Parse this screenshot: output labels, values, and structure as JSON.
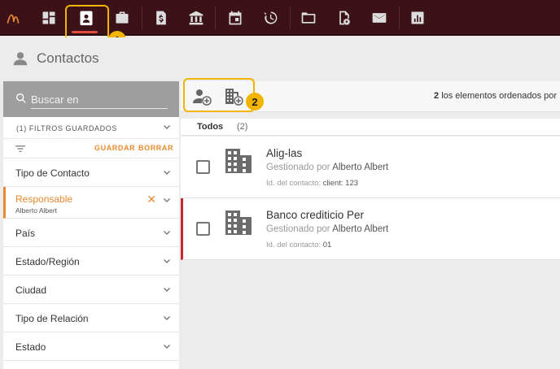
{
  "nav": {
    "items": [
      {
        "icon": "logo-icon"
      },
      {
        "icon": "dashboard-icon"
      },
      {
        "icon": "contacts-icon",
        "active": true
      },
      {
        "icon": "briefcase-icon"
      },
      {
        "icon": "billing-icon"
      },
      {
        "icon": "bank-icon"
      },
      {
        "icon": "calendar-icon"
      },
      {
        "icon": "time-icon"
      },
      {
        "icon": "folder-icon"
      },
      {
        "icon": "document-settings-icon"
      },
      {
        "icon": "mail-icon"
      },
      {
        "icon": "reports-icon"
      }
    ],
    "colors": {
      "background": "#3b1218",
      "active_underline": "#e24a3b",
      "callout": "#f2b400"
    }
  },
  "callouts": [
    "1",
    "2"
  ],
  "page": {
    "title": "Contactos",
    "icon": "person-icon"
  },
  "filters": {
    "search_placeholder": "Buscar en",
    "saved_filters_label": "(1) FILTROS GUARDADOS",
    "save_label": "GUARDAR",
    "clear_label": "BORRAR",
    "items": [
      {
        "label": "Tipo de Contacto"
      },
      {
        "label": "Responsable",
        "value": "Alberto Albert",
        "active": true
      },
      {
        "label": "País"
      },
      {
        "label": "Estado/Región"
      },
      {
        "label": "Ciudad"
      },
      {
        "label": "Tipo de Relación"
      },
      {
        "label": "Estado"
      }
    ],
    "accent_color": "#e8892d"
  },
  "toolbar": {
    "add_person_icon": "add-person-icon",
    "add_company_icon": "add-company-icon",
    "count": "2",
    "sort_text": "los elementos ordenados por"
  },
  "tabs": {
    "all_label": "Todos",
    "all_count": "(2)"
  },
  "contacts": [
    {
      "name": "Alig-las",
      "managed_prefix": "Gestionado por",
      "manager": "Alberto Albert",
      "id_label": "Id. del contacto:",
      "id_value": "client: 123",
      "flagged": false
    },
    {
      "name": "Banco crediticio Per",
      "managed_prefix": "Gestionado por",
      "manager": "Alberto Albert",
      "id_label": "Id. del contacto:",
      "id_value": "01",
      "flagged": true
    }
  ]
}
